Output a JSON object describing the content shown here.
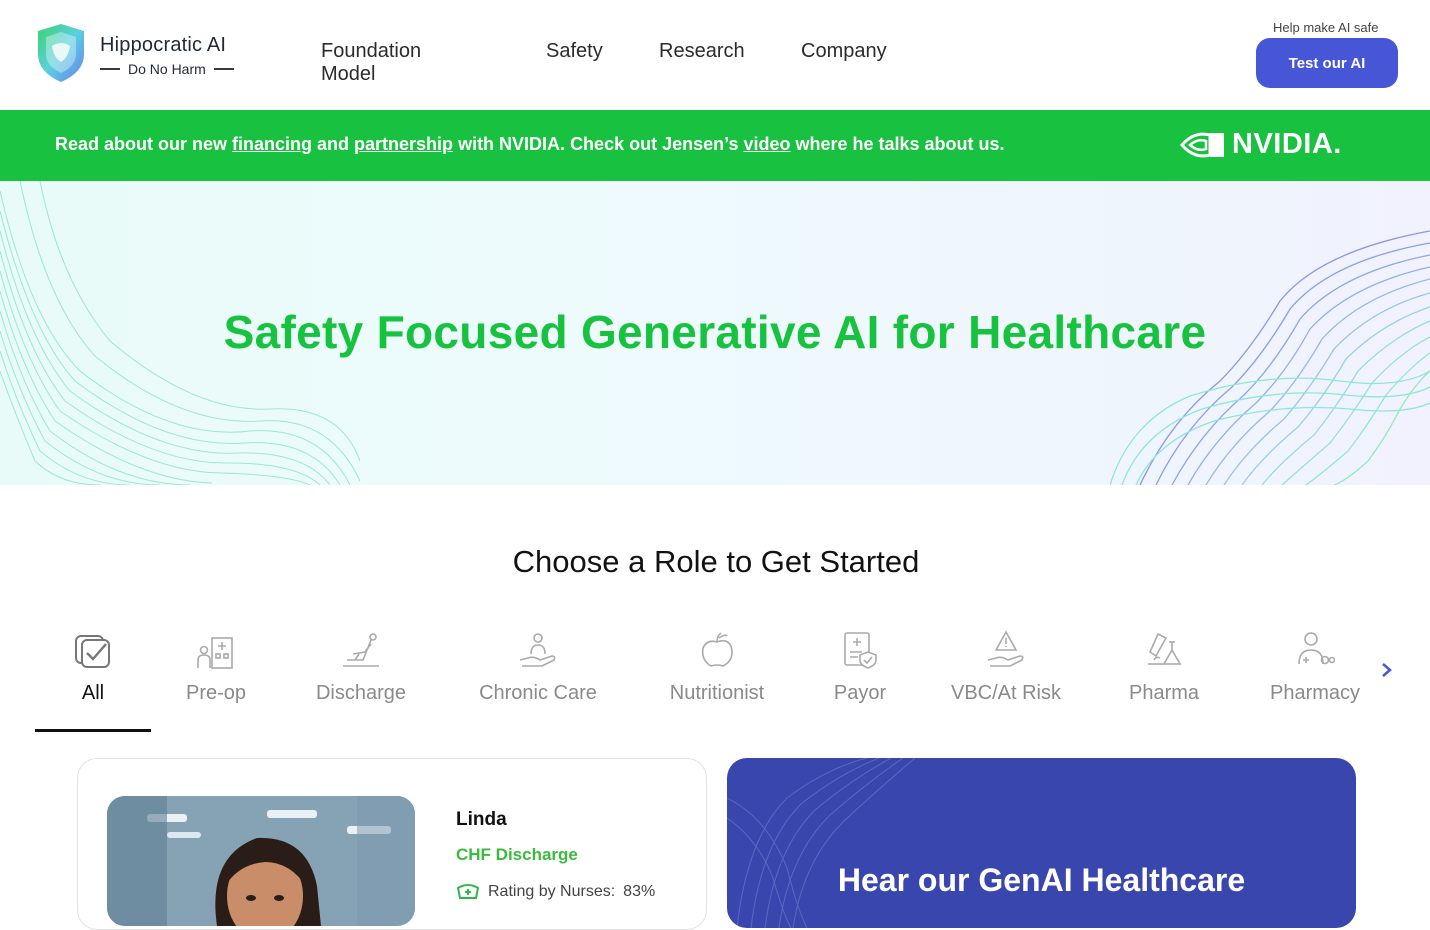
{
  "header": {
    "logo": {
      "name": "Hippocratic AI",
      "tagline": "Do No Harm"
    },
    "nav": [
      {
        "label": "Foundation Model"
      },
      {
        "label": "Safety"
      },
      {
        "label": "Research"
      },
      {
        "label": "Company"
      }
    ],
    "help_text": "Help make AI safe",
    "cta_label": "Test our AI"
  },
  "banner": {
    "text_1": "Read about our new ",
    "link_financing": "financing",
    "text_2": " and ",
    "link_partnership": "partnership",
    "text_3": " with NVIDIA. Check out Jensen’s ",
    "link_video": "video",
    "text_4": " where he talks about us.",
    "partner_logo": "NVIDIA.",
    "background": "#18c13f"
  },
  "hero": {
    "title": "Safety Focused Generative AI for Healthcare",
    "title_color": "#17c23f"
  },
  "roles": {
    "heading": "Choose a Role to Get Started",
    "tabs": [
      {
        "label": "All",
        "icon": "checkbox-icon",
        "active": true
      },
      {
        "label": "Pre-op",
        "icon": "hospital-icon"
      },
      {
        "label": "Discharge",
        "icon": "discharge-icon"
      },
      {
        "label": "Chronic Care",
        "icon": "care-hand-icon"
      },
      {
        "label": "Nutritionist",
        "icon": "apple-icon"
      },
      {
        "label": "Payor",
        "icon": "document-shield-icon"
      },
      {
        "label": "VBC/At Risk",
        "icon": "warning-hand-icon"
      },
      {
        "label": "Pharma",
        "icon": "lab-flask-icon"
      },
      {
        "label": "Pharmacy",
        "icon": "pharmacist-icon"
      }
    ]
  },
  "agent_card": {
    "name": "Linda",
    "role": "CHF Discharge",
    "rating_label": "Rating by Nurses:",
    "rating_value": "83%"
  },
  "promo_card": {
    "title": "Hear our GenAI Healthcare",
    "background": "#3946ad"
  },
  "colors": {
    "accent": "#4756d6",
    "brand_green": "#17c23f"
  }
}
